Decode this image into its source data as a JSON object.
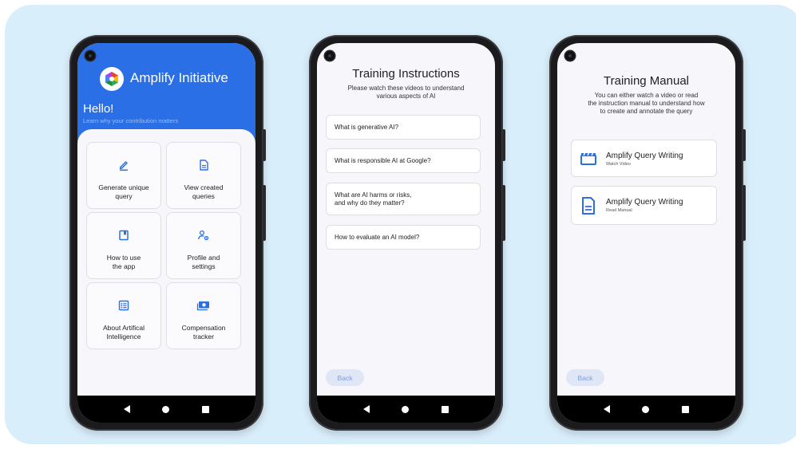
{
  "phone1": {
    "app_title": "Amplify Initiative",
    "greeting": "Hello!",
    "subtitle": "Learn why your contribution matters",
    "tiles": [
      {
        "label": "Generate unique\nquery",
        "icon": "pencil-icon"
      },
      {
        "label": "View created\nqueries",
        "icon": "document-icon"
      },
      {
        "label": "How to use\nthe app",
        "icon": "bookmark-book-icon"
      },
      {
        "label": "Profile and\nsettings",
        "icon": "user-settings-icon"
      },
      {
        "label": "About Artifical\nIntelligence",
        "icon": "list-icon"
      },
      {
        "label": "Compensation\ntracker",
        "icon": "money-icon"
      }
    ]
  },
  "phone2": {
    "title": "Training Instructions",
    "subtitle": "Please watch these videos to understand\nvarious aspects of AI",
    "questions": [
      "What is generative AI?",
      "What is responsible AI at Google?",
      "What are AI harms or risks,\nand why do they matter?",
      "How to evaluate an AI model?"
    ],
    "back_label": "Back"
  },
  "phone3": {
    "title": "Training Manual",
    "subtitle": "You can either watch a video or read\nthe instruction manual to understand how\nto create and annotate the query",
    "items": [
      {
        "title": "Amplify Query Writing",
        "sub": "Watch Video",
        "icon": "clapperboard-icon"
      },
      {
        "title": "Amplify Query Writing",
        "sub": "Read Manual",
        "icon": "document-icon"
      }
    ],
    "back_label": "Back"
  },
  "colors": {
    "primary": "#2a6fe6",
    "background": "#d9eefb",
    "back_button_bg": "#dfe6f6",
    "back_button_text": "#7f9ce0"
  }
}
